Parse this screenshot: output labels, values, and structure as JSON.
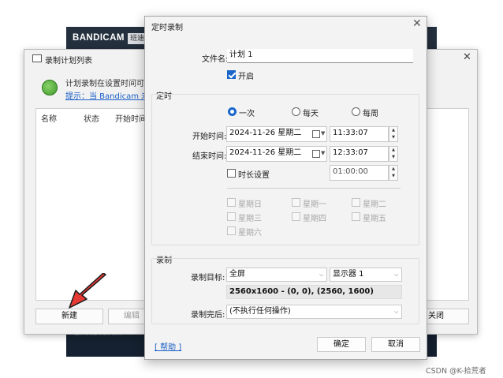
{
  "bandicam": {
    "logo_prefix": "BANDI",
    "logo_suffix": "CAM",
    "tag": "班迪"
  },
  "schedule_list": {
    "title": "录制计划列表",
    "info_text": "计划录制在设置时间可以",
    "info_link": "提示：当 Bandicam 未运",
    "columns": [
      "名称",
      "状态",
      "开始时间"
    ],
    "buttons": {
      "new": "新建",
      "edit": "编辑",
      "close": "关闭"
    }
  },
  "dialog": {
    "title": "定时录制",
    "filename_label": "文件名:",
    "filename_value": "计划 1",
    "enable_label": "开启",
    "enable_checked": true,
    "timing_group": "定时",
    "repeat_options": [
      "一次",
      "每天",
      "每周"
    ],
    "repeat_selected": "一次",
    "start_label": "开始时间:",
    "start_date": "2024-11-26 星期二",
    "start_time": "11:33:07",
    "end_label": "结束时间:",
    "end_date": "2024-11-26 星期二",
    "end_time": "12:33:07",
    "duration_label": "时长设置",
    "duration_value": "01:00:00",
    "weekdays": [
      "星期日",
      "星期一",
      "星期二",
      "星期三",
      "星期四",
      "星期五",
      "星期六"
    ],
    "record_group": "录制",
    "target_label": "录制目标:",
    "target_value": "全屏",
    "monitor_value": "显示器 1",
    "resolution_text": "2560x1600 - (0, 0), (2560, 1600)",
    "after_label": "录制完后:",
    "after_value": "(不执行任何操作)",
    "help_link": "[ 帮助 ]",
    "ok_label": "确定",
    "cancel_label": "取消"
  },
  "watermark": "CSDN @K-拾荒者",
  "colors": {
    "accent": "#1a66cc",
    "arrow": "#e53935",
    "bandicam_bg": "#1e2a38"
  }
}
